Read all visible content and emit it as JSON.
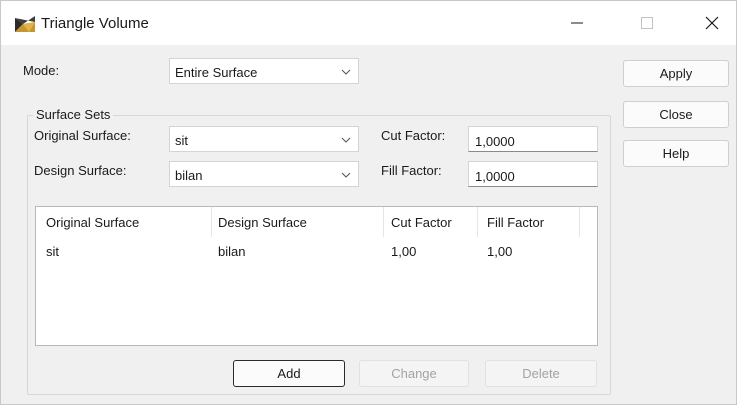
{
  "window": {
    "title": "Triangle Volume",
    "controls": {
      "minimize": "—",
      "maximize": "☐",
      "close": "✕"
    }
  },
  "mode": {
    "label": "Mode:",
    "value": "Entire Surface"
  },
  "surface_sets": {
    "title": "Surface Sets",
    "original": {
      "label": "Original Surface:",
      "value": "sit"
    },
    "design": {
      "label": "Design Surface:",
      "value": "bilan"
    },
    "cut": {
      "label": "Cut Factor:",
      "value": "1,0000"
    },
    "fill": {
      "label": "Fill Factor:",
      "value": "1,0000"
    }
  },
  "table": {
    "columns": [
      "Original Surface",
      "Design Surface",
      "Cut Factor",
      "Fill Factor"
    ],
    "rows": [
      [
        "sit",
        "bilan",
        "1,00",
        "1,00"
      ]
    ]
  },
  "buttons": {
    "apply": "Apply",
    "close": "Close",
    "help": "Help",
    "add": "Add",
    "change": "Change",
    "delete": "Delete"
  }
}
